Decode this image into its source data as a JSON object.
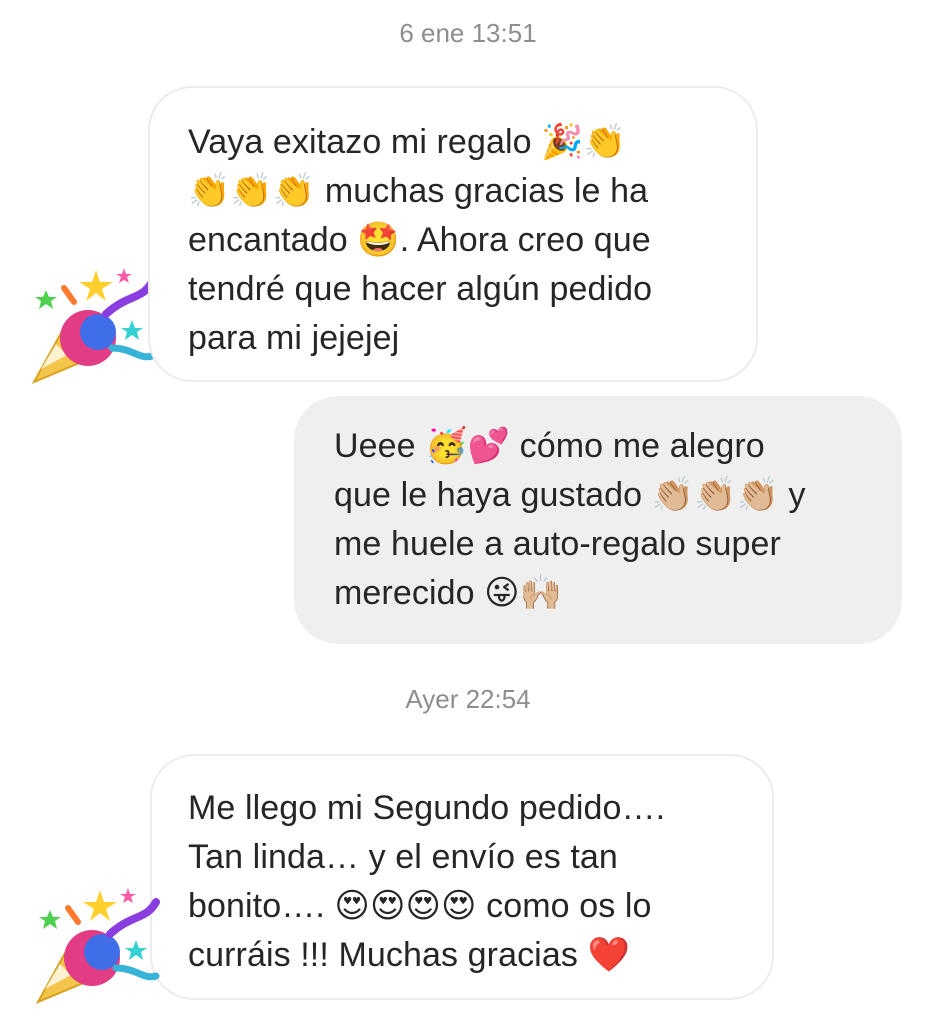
{
  "conversation": {
    "timestamps": [
      "6 ene 13:51",
      "Ayer 22:54"
    ],
    "messages": [
      {
        "direction": "incoming",
        "lines": [
          "Vaya exitazo mi regalo 🎉👏",
          "👏👏👏 muchas gracias le ha",
          "encantado 🤩. Ahora creo que",
          "tendré que hacer algún pedido",
          "para mi jejejej"
        ]
      },
      {
        "direction": "outgoing",
        "lines": [
          "Ueee 🥳💕 cómo me alegro",
          "que le haya gustado 👏🏼👏🏼👏🏼 y",
          "me huele a auto-regalo super",
          "merecido 😜🙌🏼"
        ]
      },
      {
        "direction": "incoming",
        "lines": [
          "Me llego mi Segundo pedido….",
          "Tan linda… y el envío es tan",
          "bonito…. 😍😍😍😍 como os lo",
          "curráis !!! Muchas gracias ❤️"
        ]
      }
    ],
    "avatar_icon": "party-popper-icon"
  }
}
